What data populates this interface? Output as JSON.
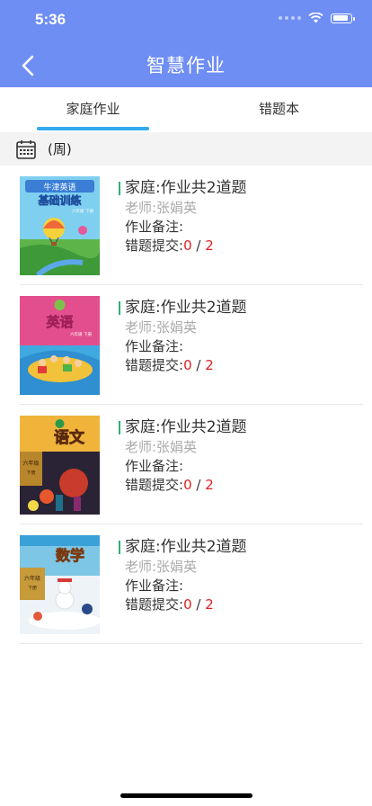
{
  "status": {
    "time": "5:36"
  },
  "header": {
    "title": "智慧作业"
  },
  "tabs": [
    {
      "label": "家庭作业",
      "active": true
    },
    {
      "label": "错题本",
      "active": false
    }
  ],
  "week": {
    "label": "(周)"
  },
  "items": [
    {
      "cover_title": "牛津英语",
      "cover_subtitle": "基础训练",
      "cover_grade": "六年级 下册",
      "title": "家庭:作业共2道题",
      "teacher": "老师:张娟英",
      "note": "作业备注:",
      "err_label": "错题提交:",
      "err_done": "0",
      "err_sep": " / ",
      "err_total": "2"
    },
    {
      "cover_title": "英语",
      "cover_grade": "六年级 下册",
      "title": "家庭:作业共2道题",
      "teacher": "老师:张娟英",
      "note": "作业备注:",
      "err_label": "错题提交:",
      "err_done": "0",
      "err_sep": " / ",
      "err_total": "2"
    },
    {
      "cover_title": "语文",
      "cover_grade": "六年级",
      "cover_term": "下册",
      "title": "家庭:作业共2道题",
      "teacher": "老师:张娟英",
      "note": "作业备注:",
      "err_label": "错题提交:",
      "err_done": "0",
      "err_sep": " / ",
      "err_total": "2"
    },
    {
      "cover_title": "数学",
      "cover_grade": "六年级",
      "cover_term": "下册",
      "title": "家庭:作业共2道题",
      "teacher": "老师:张娟英",
      "note": "作业备注:",
      "err_label": "错题提交:",
      "err_done": "0",
      "err_sep": " / ",
      "err_total": "2"
    }
  ],
  "colors": {
    "header": "#6f8ef3",
    "tab_indicator": "#33aaf0",
    "accent_bar": "#2ab07a",
    "error": "#e02020"
  }
}
